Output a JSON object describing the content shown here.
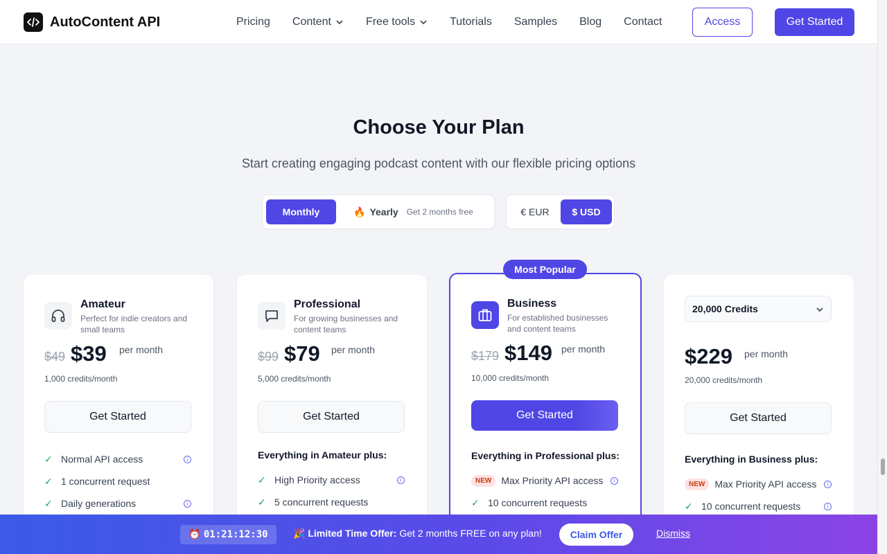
{
  "header": {
    "logo_text": "AutoContent API",
    "nav": [
      {
        "label": "Pricing",
        "dropdown": false
      },
      {
        "label": "Content",
        "dropdown": true
      },
      {
        "label": "Free tools",
        "dropdown": true
      },
      {
        "label": "Tutorials",
        "dropdown": false
      },
      {
        "label": "Samples",
        "dropdown": false
      },
      {
        "label": "Blog",
        "dropdown": false
      },
      {
        "label": "Contact",
        "dropdown": false
      }
    ],
    "access_label": "Access",
    "get_started_label": "Get Started"
  },
  "hero": {
    "title": "Choose Your Plan",
    "subtitle": "Start creating engaging podcast content with our flexible pricing options"
  },
  "toggles": {
    "monthly": "Monthly",
    "yearly": "Yearly",
    "yearly_emoji": "🔥",
    "yearly_note": "Get 2 months free",
    "eur": "€ EUR",
    "usd": "$ USD",
    "selected_period": "Monthly",
    "selected_currency": "$ USD"
  },
  "popular_badge": "Most Popular",
  "plans": [
    {
      "name": "Amateur",
      "icon": "headphones-icon",
      "desc": "Perfect for indie creators and small teams",
      "old_price": "$49",
      "price": "$39",
      "per": "per month",
      "credits": "1,000 credits/month",
      "cta": "Get Started",
      "features": [
        {
          "text": "Normal API access",
          "info": true
        },
        {
          "text": "1 concurrent request",
          "info": false
        },
        {
          "text": "Daily generations",
          "info": true
        }
      ]
    },
    {
      "name": "Professional",
      "icon": "chat-icon",
      "desc": "For growing businesses and content teams",
      "old_price": "$99",
      "price": "$79",
      "per": "per month",
      "credits": "5,000 credits/month",
      "cta": "Get Started",
      "features_head": "Everything in Amateur plus:",
      "features": [
        {
          "text": "High Priority access",
          "info": true
        },
        {
          "text": "5 concurrent requests",
          "info": false
        }
      ]
    },
    {
      "name": "Business",
      "icon": "briefcase-icon",
      "desc": "For established businesses and content teams",
      "old_price": "$179",
      "price": "$149",
      "per": "per month",
      "credits": "10,000 credits/month",
      "cta": "Get Started",
      "features_head": "Everything in Professional plus:",
      "features": [
        {
          "badge": "NEW",
          "text": "Max Priority API access",
          "info": true
        },
        {
          "text": "10 concurrent requests",
          "info": false
        }
      ]
    },
    {
      "credit_select": "20,000 Credits",
      "price": "$229",
      "per": "per month",
      "credits": "20,000 credits/month",
      "cta": "Get Started",
      "features_head": "Everything in Business plus:",
      "features": [
        {
          "badge": "NEW",
          "text": "Max Priority API access",
          "info": true
        },
        {
          "text": "10 concurrent requests",
          "info": true
        }
      ]
    }
  ],
  "promo": {
    "timer": "01:21:12:30",
    "emoji": "🎉",
    "headline": "Limited Time Offer:",
    "message": "Get 2 months FREE on any plan!",
    "claim": "Claim Offer",
    "dismiss": "Dismiss"
  },
  "colors": {
    "accent": "#4f46e5",
    "check": "#22a06b",
    "background": "#f3f4f7"
  }
}
